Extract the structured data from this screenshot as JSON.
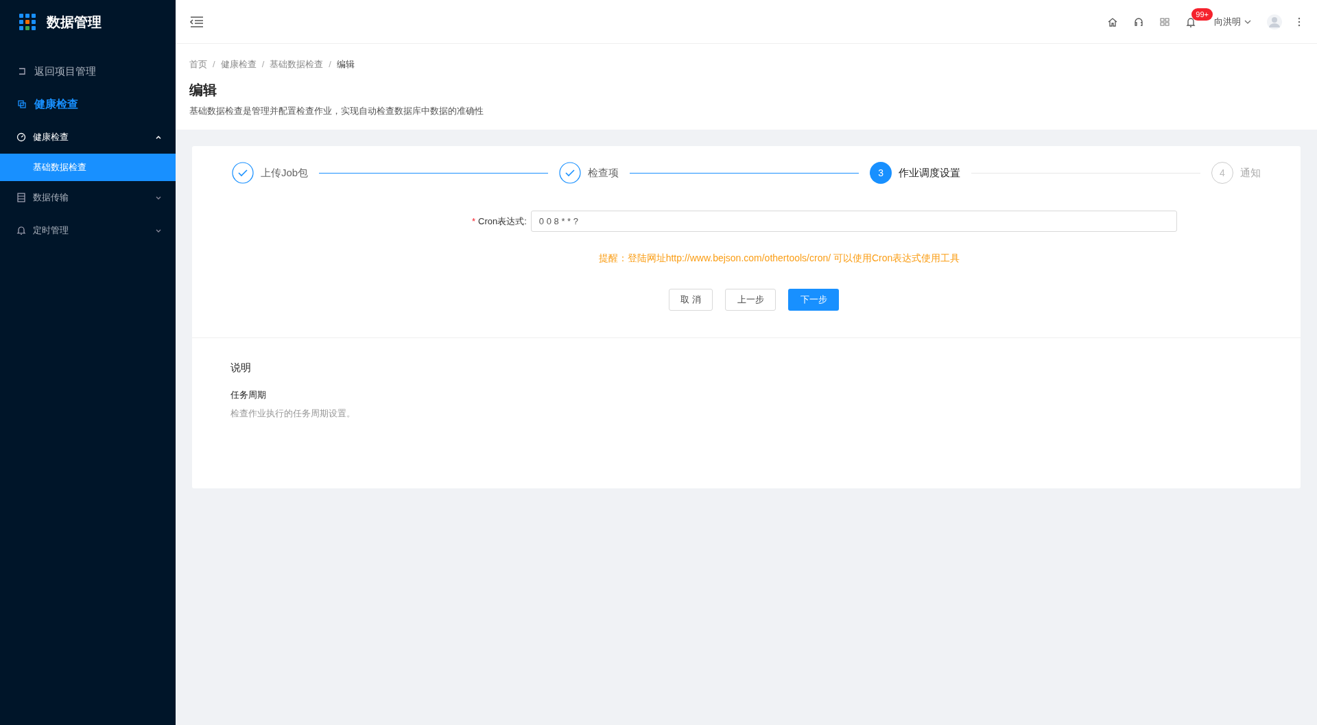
{
  "app": {
    "title": "数据管理"
  },
  "sidebar": {
    "items": [
      {
        "kind": "back",
        "label": "返回项目管理"
      },
      {
        "kind": "section",
        "label": "健康检查"
      },
      {
        "kind": "group",
        "label": "健康检查",
        "expanded": true,
        "children": [
          {
            "label": "基础数据检查",
            "selected": true
          }
        ]
      },
      {
        "kind": "group",
        "label": "数据传输",
        "expanded": false
      },
      {
        "kind": "group",
        "label": "定时管理",
        "expanded": false
      }
    ]
  },
  "header": {
    "badge": "99+",
    "user": "向洪明"
  },
  "breadcrumb": {
    "separator": "/",
    "items": [
      "首页",
      "健康检查",
      "基础数据检查",
      "编辑"
    ]
  },
  "page": {
    "title": "编辑",
    "description": "基础数据检查是管理并配置检查作业，实现自动检查数据库中数据的准确性"
  },
  "steps": [
    {
      "label": "上传Job包",
      "finished": true,
      "selected": false
    },
    {
      "label": "检查项",
      "finished": true,
      "selected": false
    },
    {
      "number": "3",
      "label": "作业调度设置",
      "finished": false,
      "selected": true
    },
    {
      "number": "4",
      "label": "通知",
      "finished": false,
      "selected": false
    }
  ],
  "form": {
    "required_mark": "*",
    "label": "Cron表达式:",
    "value": "0 0 8 * * ?",
    "tip": "提醒：登陆网址http://www.bejson.com/othertools/cron/ 可以使用Cron表达式使用工具"
  },
  "buttons": [
    {
      "label": "取 消",
      "kind": "default"
    },
    {
      "label": "上一步",
      "kind": "default"
    },
    {
      "label": "下一步",
      "kind": "primary"
    }
  ],
  "explanation": {
    "title": "说明",
    "heading": "任务周期",
    "text": "检查作业执行的任务周期设置。"
  }
}
